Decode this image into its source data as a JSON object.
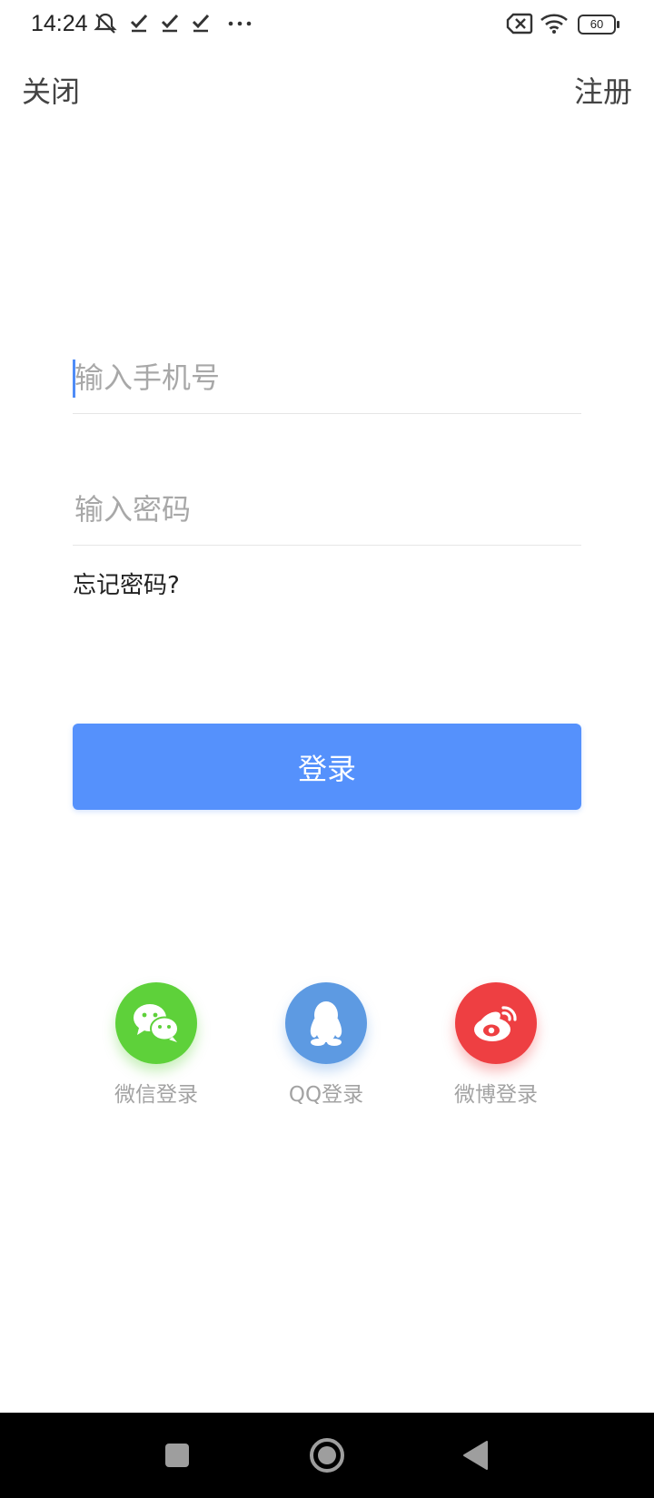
{
  "status_bar": {
    "time": "14:24",
    "battery": "60",
    "icons": [
      "silent-icon",
      "check-icon",
      "check-icon",
      "check-icon",
      "more-dots-icon",
      "no-sim-icon",
      "wifi-icon",
      "battery-icon"
    ]
  },
  "header": {
    "close_label": "关闭",
    "register_label": "注册"
  },
  "form": {
    "phone_placeholder": "输入手机号",
    "phone_value": "",
    "password_placeholder": "输入密码",
    "password_value": "",
    "forgot_label": "忘记密码?",
    "login_label": "登录"
  },
  "social": [
    {
      "label": "微信登录",
      "icon": "wechat-icon",
      "color": "#5ed13a"
    },
    {
      "label": "QQ登录",
      "icon": "qq-icon",
      "color": "#5d9ae2"
    },
    {
      "label": "微博登录",
      "icon": "weibo-icon",
      "color": "#ee3f42"
    }
  ],
  "colors": {
    "accent": "#5591fc",
    "caret": "#4f8cf7"
  },
  "nav_bar": {
    "icons": [
      "recent-apps-icon",
      "home-icon",
      "back-icon"
    ]
  }
}
